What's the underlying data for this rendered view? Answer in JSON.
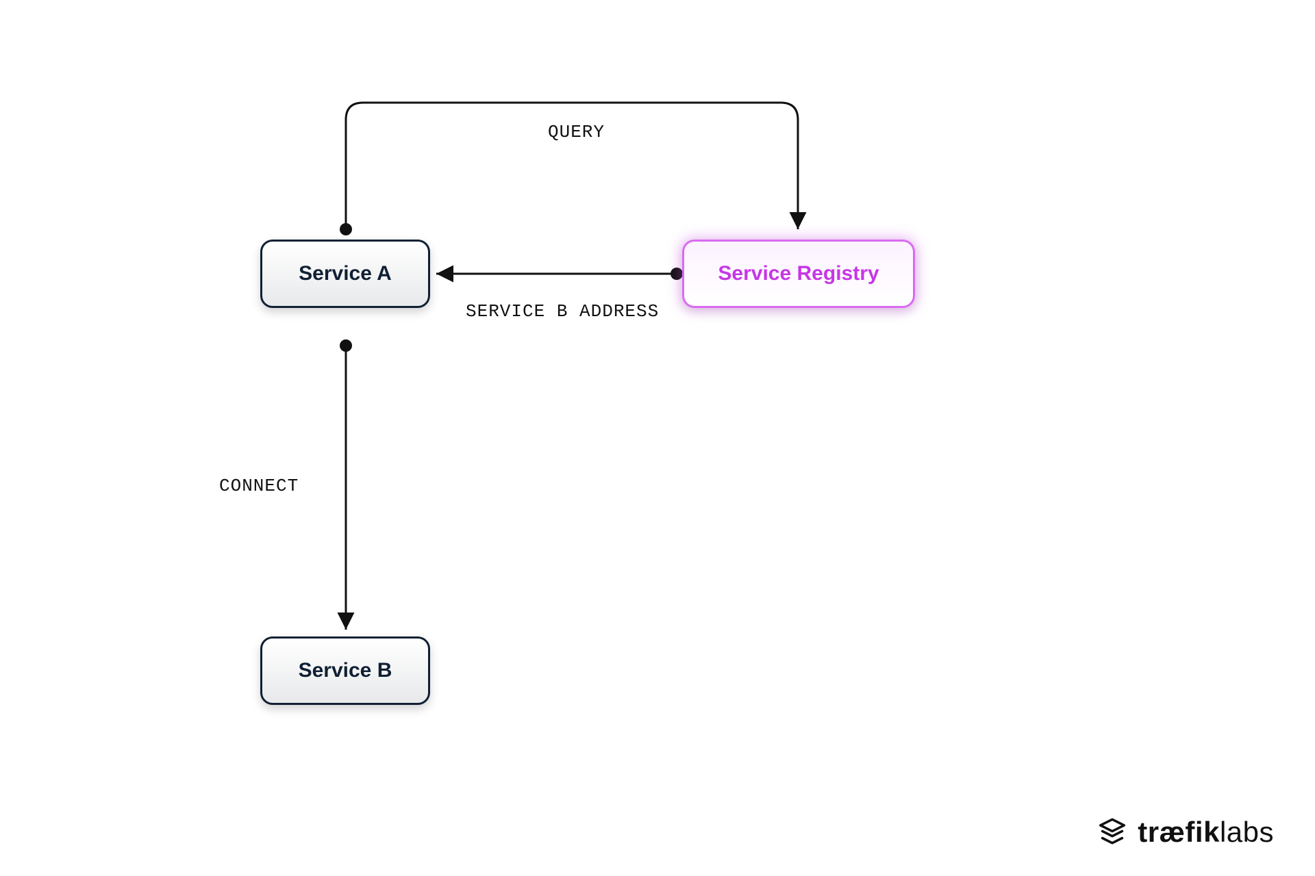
{
  "nodes": {
    "serviceA": {
      "label": "Service A"
    },
    "serviceB": {
      "label": "Service B"
    },
    "registry": {
      "label": "Service Registry"
    }
  },
  "edges": {
    "query": {
      "label": "QUERY"
    },
    "address": {
      "label": "SERVICE B ADDRESS"
    },
    "connect": {
      "label": "CONNECT"
    }
  },
  "brand": {
    "bold": "træfik",
    "light": "labs"
  }
}
